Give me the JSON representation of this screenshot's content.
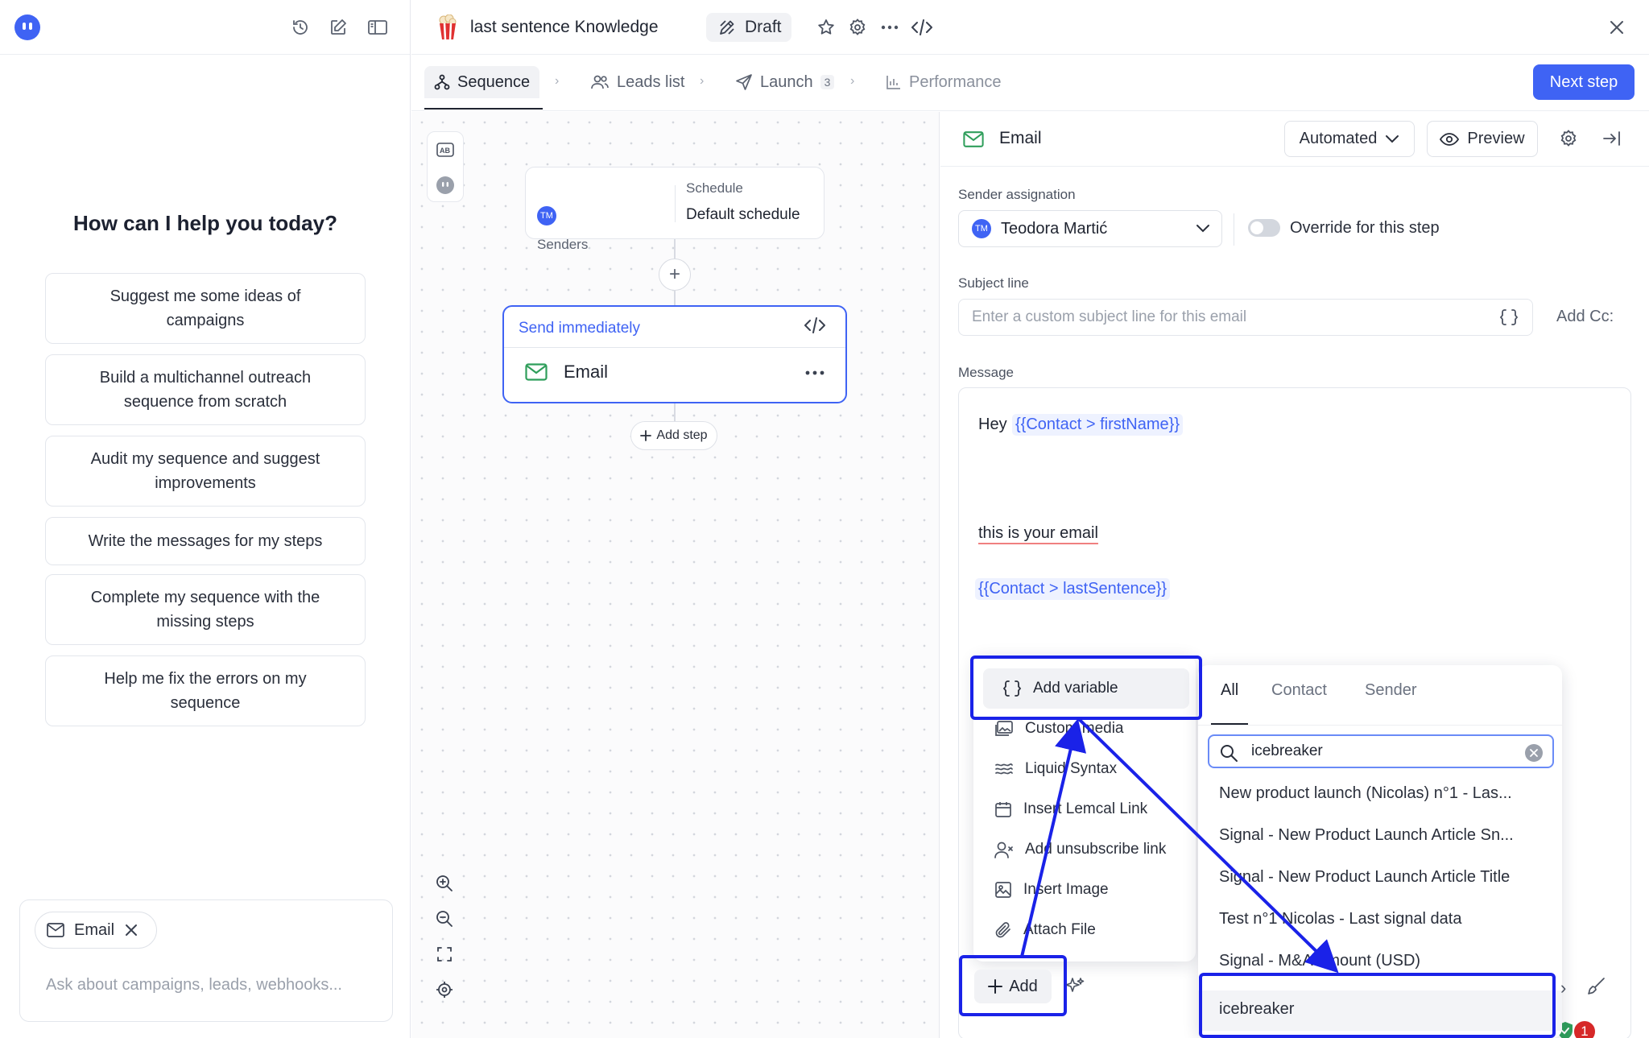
{
  "assistant": {
    "title": "How can I help you today?",
    "suggestions": [
      "Suggest me some ideas of campaigns",
      "Build a multichannel outreach sequence from scratch",
      "Audit my sequence and suggest improvements",
      "Write the messages for my steps",
      "Complete my sequence with the missing steps",
      "Help me fix the errors on my sequence"
    ],
    "chip_label": "Email",
    "input_placeholder": "Ask about campaigns, leads, webhooks..."
  },
  "header": {
    "campaign_title": "last sentence Knowledge",
    "status_badge": "Draft"
  },
  "tabs": [
    {
      "label": "Sequence",
      "active": true
    },
    {
      "label": "Leads list"
    },
    {
      "label": "Launch",
      "count": "3"
    },
    {
      "label": "Performance"
    }
  ],
  "next_step_label": "Next step",
  "canvas": {
    "senders_label": "Senders",
    "sender_initials": "TM",
    "schedule_label": "Schedule",
    "schedule_value": "Default schedule",
    "step_timing": "Send immediately",
    "step_name": "Email",
    "add_step_label": "Add step"
  },
  "editor": {
    "title": "Email",
    "mode": "Automated",
    "preview_label": "Preview",
    "sender_assignation_label": "Sender assignation",
    "sender_initials": "TM",
    "sender_name": "Teodora Martić",
    "override_label": "Override for this step",
    "subject_label": "Subject line",
    "subject_placeholder": "Enter a custom subject line for this email",
    "add_cc_label": "Add Cc:",
    "message_label": "Message",
    "message": {
      "greeting": "Hey",
      "greeting_variable": "{{Contact > firstName}}",
      "body_line": "this is your email",
      "body_variable": "{{Contact > lastSentence}}"
    },
    "error_count": "1"
  },
  "add_menu": {
    "items": [
      "Add variable",
      "Custom media",
      "Liquid Syntax",
      "Insert Lemcal Link",
      "Add unsubscribe link",
      "Insert Image",
      "Attach File"
    ],
    "add_button_label": "Add"
  },
  "variable_menu": {
    "tabs": [
      "All",
      "Contact",
      "Sender"
    ],
    "search_value": "icebreaker",
    "results": [
      "New product launch (Nicolas) n°1 - Las...",
      "Signal - New Product Launch Article Sn...",
      "Signal - New Product Launch Article Title",
      "Test n°1 Nicolas - Last signal data",
      "Signal - M&A Amount (USD)",
      "icebreaker"
    ]
  },
  "colors": {
    "accent": "#3f63f4",
    "annotation": "#1a22e8",
    "variable_chip_bg": "#eef2ff",
    "error_badge": "#d62828",
    "email_icon": "#2f9e5b"
  }
}
